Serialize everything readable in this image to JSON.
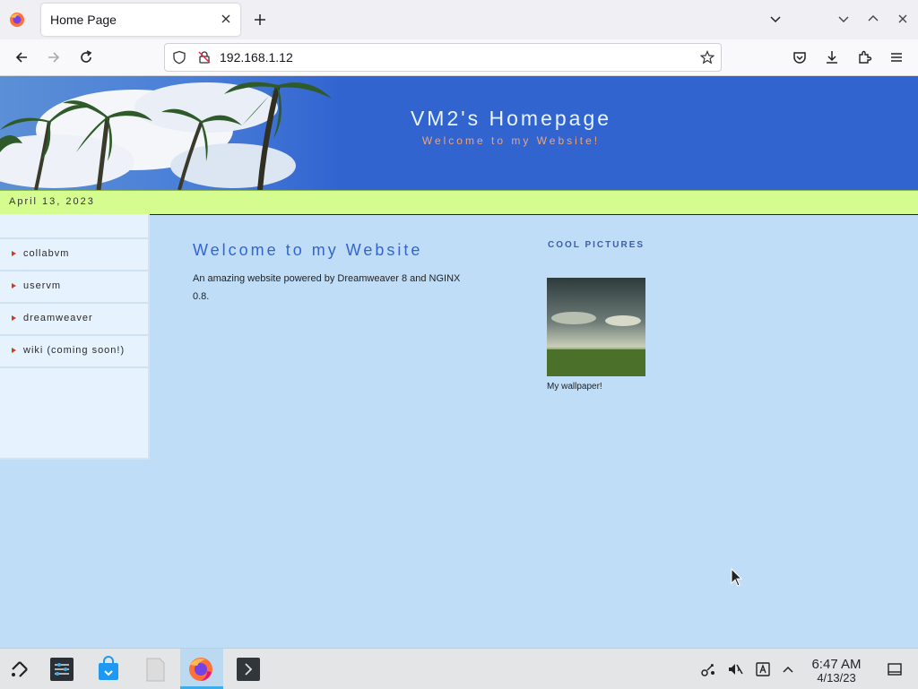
{
  "browser": {
    "tab_title": "Home Page",
    "url": "192.168.1.12"
  },
  "site": {
    "title": "VM2's Homepage",
    "tagline": "Welcome to my Website!",
    "date": "April 13, 2023",
    "nav": [
      {
        "label": "collabvm"
      },
      {
        "label": "uservm"
      },
      {
        "label": "dreamweaver"
      },
      {
        "label": "wiki (coming soon!)"
      }
    ],
    "main_heading": "Welcome to my Website",
    "main_text": "An amazing website powered by Dreamweaver 8 and NGINX 0.8.",
    "pictures_heading": "COOL PICTURES",
    "picture_caption": "My wallpaper!"
  },
  "taskbar": {
    "time": "6:47 AM",
    "date": "4/13/23"
  },
  "colors": {
    "header_blue": "#3264d0",
    "date_bar_green": "#d4fc8e",
    "page_bg": "#c0ddf8",
    "heading_blue": "#3366cc",
    "tagline_orange": "#f3a36a"
  }
}
